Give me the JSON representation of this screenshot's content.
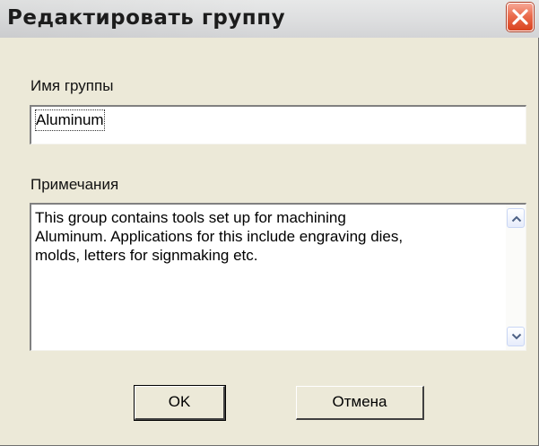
{
  "dialog": {
    "title": "Редактировать группу",
    "close_icon": "close-icon"
  },
  "name_field": {
    "label": "Имя группы",
    "value": "Aluminum"
  },
  "notes_field": {
    "label": "Примечания",
    "value": "This group contains tools set up for machining\nAluminum. Applications for this include engraving dies,\nmolds, letters for signmaking etc."
  },
  "buttons": {
    "ok_label": "OK",
    "cancel_label": "Отмена"
  },
  "colors": {
    "dialog_bg": "#ece9d8",
    "close_button": "#e05a3a"
  }
}
